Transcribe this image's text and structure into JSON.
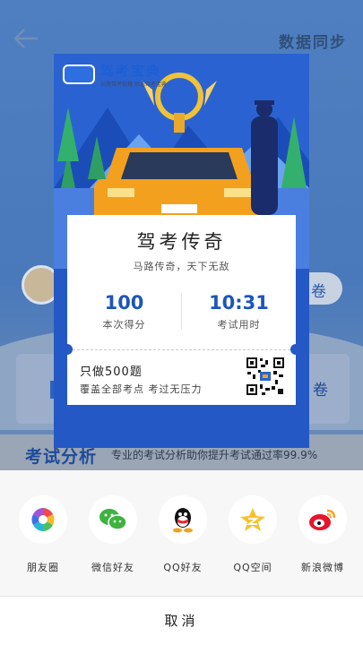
{
  "background": {
    "header_right": "数据同步",
    "pill_label": "卷",
    "card_right": "卷",
    "analysis_title": "考试分析",
    "analysis_desc": "专业的考试分析助你提升考试通过率99.9%"
  },
  "poster": {
    "brand": "驾考宝典",
    "brand_sub": "出路驾考秘籍  就选驾考宝典",
    "title": "驾考传奇",
    "subtitle": "马路传奇，天下无敌",
    "stats": [
      {
        "value": "100",
        "label": "本次得分"
      },
      {
        "value": "10:31",
        "label": "考试用时"
      }
    ],
    "promo_line1": "只做500题",
    "promo_line2": "覆盖全部考点 考过无压力"
  },
  "share": {
    "items": [
      {
        "label": "朋友圈",
        "icon": "moments-icon"
      },
      {
        "label": "微信好友",
        "icon": "wechat-icon"
      },
      {
        "label": "QQ好友",
        "icon": "qq-icon"
      },
      {
        "label": "QQ空间",
        "icon": "qzone-icon"
      },
      {
        "label": "新浪微博",
        "icon": "weibo-icon"
      }
    ],
    "cancel_label": "取消"
  },
  "colors": {
    "brand_blue": "#2458c4",
    "stat_blue": "#1d56b8",
    "car_orange": "#f3a01f"
  }
}
